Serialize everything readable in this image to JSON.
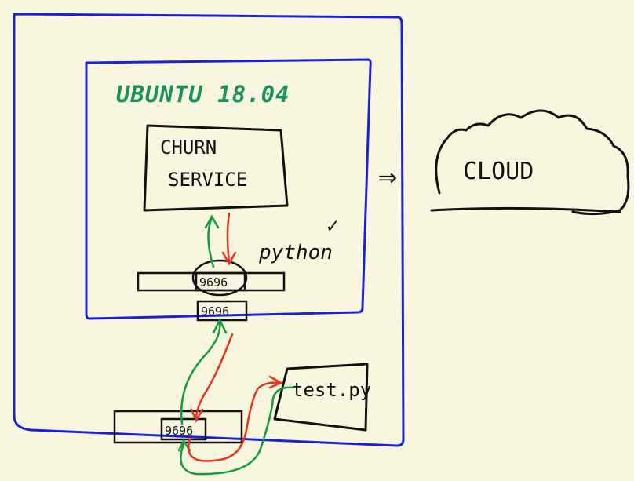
{
  "os_label": "UBUNTU 18.04",
  "service": {
    "line1": "CHURN",
    "line2": "SERVICE"
  },
  "language_label": "python",
  "check_mark": "✓",
  "ports": {
    "container_inner": "9696",
    "container_outer": "9696",
    "host": "9696"
  },
  "script_label": "test.py",
  "cloud_label": "CLOUD",
  "deploy_arrow": "⇒",
  "colors": {
    "outline": "#1a22d6",
    "ink": "#111111",
    "os_text": "#18915a",
    "request": "#139a3c",
    "response": "#e8321c",
    "background": "#f8f6df"
  }
}
